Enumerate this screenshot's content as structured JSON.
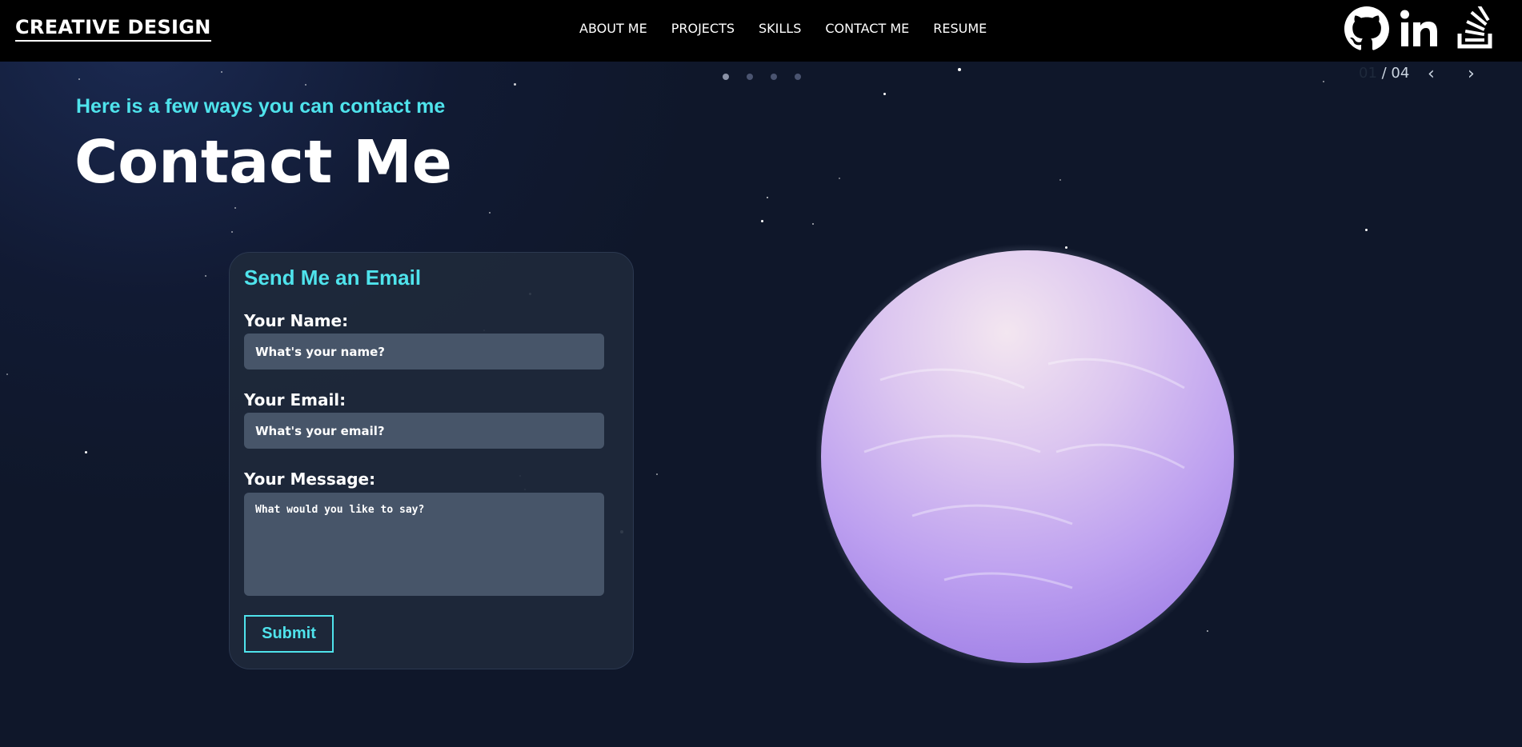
{
  "header": {
    "brand": "CREATIVE DESIGN",
    "nav": [
      "ABOUT ME",
      "PROJECTS",
      "SKILLS",
      "CONTACT ME",
      "RESUME"
    ],
    "social_icons": [
      "github-icon",
      "linkedin-icon",
      "stackoverflow-icon"
    ]
  },
  "slider": {
    "current": "01",
    "total": "/ 04",
    "prev": "‹",
    "next": "›",
    "active_index": 0
  },
  "hero": {
    "subtitle": "Here is a few ways you can contact me",
    "title": "Contact Me"
  },
  "form": {
    "heading": "Send Me an Email",
    "name_label": "Your Name:",
    "name_placeholder": "What's your name?",
    "email_label": "Your Email:",
    "email_placeholder": "What's your email?",
    "message_label": "Your Message:",
    "message_placeholder": "What would you like to say?",
    "submit": "Submit"
  },
  "colors": {
    "accent": "#4fe3ec",
    "planet": "#b69af0",
    "background": "#0f172a"
  }
}
